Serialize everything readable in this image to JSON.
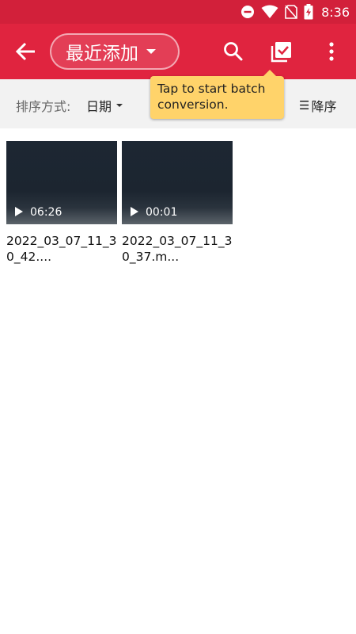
{
  "status_bar": {
    "time": "8:36",
    "icons": [
      "do-not-disturb-icon",
      "wifi-icon",
      "no-sim-icon",
      "battery-charging-icon"
    ]
  },
  "app_bar": {
    "album_title": "最近添加",
    "icons": [
      "back-arrow-icon",
      "search-icon",
      "batch-select-icon",
      "more-vert-icon"
    ],
    "accent_color": "#e0243f"
  },
  "sort_bar": {
    "label": "排序方式:",
    "value": "日期",
    "order": "降序"
  },
  "tooltip": {
    "text": "Tap to start batch conversion.",
    "color": "#ffd36a"
  },
  "videos": [
    {
      "duration": "06:26",
      "name": "2022_03_07_11_30_42...."
    },
    {
      "duration": "00:01",
      "name": "2022_03_07_11_30_37.m..."
    }
  ]
}
